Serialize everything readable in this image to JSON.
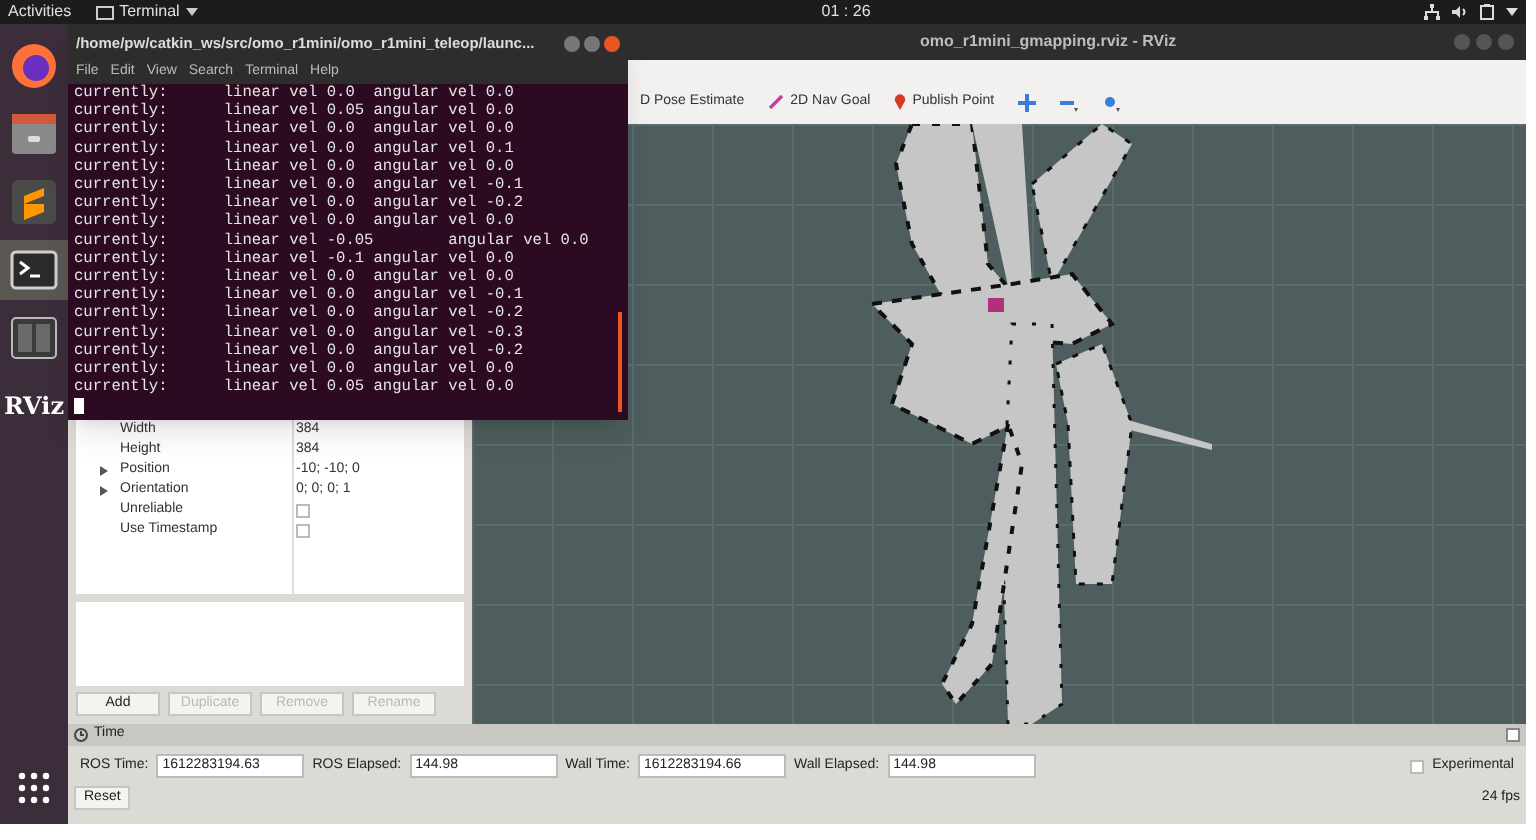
{
  "top_bar": {
    "activities": "Activities",
    "app_menu": "Terminal",
    "clock": "01 : 26"
  },
  "dock": [
    {
      "kind": "firefox",
      "selected": false
    },
    {
      "kind": "files",
      "selected": false
    },
    {
      "kind": "editor",
      "selected": false
    },
    {
      "kind": "terminal",
      "selected": true
    },
    {
      "kind": "switcher",
      "selected": false
    },
    {
      "kind": "rviz",
      "label": "RViz",
      "selected": false
    }
  ],
  "rviz": {
    "title": "omo_r1mini_gmapping.rviz - RViz",
    "tools": [
      {
        "kind": "pose",
        "label": "D Pose Estimate"
      },
      {
        "kind": "goal",
        "label": "2D Nav Goal"
      },
      {
        "kind": "point",
        "label": "Publish Point"
      }
    ],
    "properties": [
      {
        "kind": "value",
        "label": "Width",
        "value": "384",
        "expandable": false
      },
      {
        "kind": "value",
        "label": "Height",
        "value": "384",
        "expandable": false
      },
      {
        "kind": "value",
        "label": "Position",
        "value": "-10; -10; 0",
        "expandable": true
      },
      {
        "kind": "value",
        "label": "Orientation",
        "value": "0; 0; 0; 1",
        "expandable": true
      },
      {
        "kind": "checkbox",
        "label": "Unreliable",
        "checked": false
      },
      {
        "kind": "checkbox",
        "label": "Use Timestamp",
        "checked": false
      }
    ],
    "buttons": [
      {
        "label": "Add",
        "disabled": false
      },
      {
        "label": "Duplicate",
        "disabled": true
      },
      {
        "label": "Remove",
        "disabled": true
      },
      {
        "label": "Rename",
        "disabled": true
      }
    ]
  },
  "time_panel": {
    "title": "Time",
    "fields": [
      {
        "label": "ROS Time:",
        "value": "1612283194.63"
      },
      {
        "label": "ROS Elapsed:",
        "value": "144.98"
      },
      {
        "label": "Wall Time:",
        "value": "1612283194.66"
      },
      {
        "label": "Wall Elapsed:",
        "value": "144.98"
      }
    ],
    "experimental": {
      "label": "Experimental",
      "checked": false
    },
    "reset": "Reset",
    "fps": "24 fps"
  },
  "terminal": {
    "title": "/home/pw/catkin_ws/src/omo_r1mini/omo_r1mini_teleop/launc...",
    "menu": [
      "File",
      "Edit",
      "View",
      "Search",
      "Terminal",
      "Help"
    ],
    "lines": [
      "currently:\tlinear vel 0.0\tangular vel 0.0",
      "currently:\tlinear vel 0.05\tangular vel 0.0",
      "currently:\tlinear vel 0.0\tangular vel 0.0",
      "currently:\tlinear vel 0.0\tangular vel 0.1",
      "currently:\tlinear vel 0.0\tangular vel 0.0",
      "currently:\tlinear vel 0.0\tangular vel -0.1",
      "currently:\tlinear vel 0.0\tangular vel -0.2",
      "currently:\tlinear vel 0.0\tangular vel 0.0",
      "currently:\tlinear vel -0.05\tangular vel 0.0",
      "currently:\tlinear vel -0.1\tangular vel 0.0",
      "currently:\tlinear vel 0.0\tangular vel 0.0",
      "currently:\tlinear vel 0.0\tangular vel -0.1",
      "currently:\tlinear vel 0.0\tangular vel -0.2",
      "currently:\tlinear vel 0.0\tangular vel -0.3",
      "currently:\tlinear vel 0.0\tangular vel -0.2",
      "currently:\tlinear vel 0.0\tangular vel 0.0",
      "currently:\tlinear vel 0.05\tangular vel 0.0"
    ]
  }
}
